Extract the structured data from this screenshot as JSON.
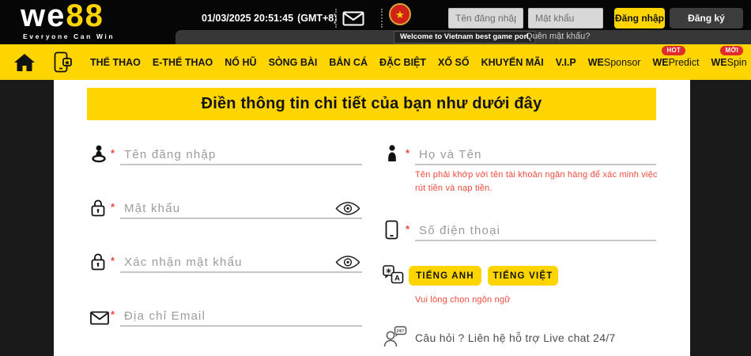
{
  "header": {
    "logo_we": "we",
    "logo_88": "88",
    "tagline": "Everyone Can Win",
    "datetime": "01/03/2025 20:51:45",
    "timezone": "(GMT+8)",
    "username_placeholder": "Tên đăng nhập",
    "password_placeholder": "Mật khẩu",
    "login_label": "Đăng nhập",
    "register_label": "Đăng ký",
    "forgot_label": "Quên mật khẩu?",
    "ticker": "Welcome to Vietnam best game porl",
    "flag_star": "★"
  },
  "nav": {
    "items": [
      "THỂ THAO",
      "E-THỂ THAO",
      "NỔ HŨ",
      "SÒNG BÀI",
      "BẮN CÁ",
      "ĐẶC BIỆT",
      "XỔ SỐ",
      "KHUYẾN MÃI",
      "V.I.P"
    ],
    "we_items": [
      {
        "prefix": "WE",
        "rest": "Sponsor"
      },
      {
        "prefix": "WE",
        "rest": "Predict",
        "badge": "HOT"
      },
      {
        "prefix": "WE",
        "rest": "Spin",
        "badge": "MỚI"
      }
    ]
  },
  "form": {
    "title": "Điền thông tin chi tiết của bạn như dưới đây",
    "required_marker": "*",
    "username_placeholder": "Tên đăng nhập",
    "password_placeholder": "Mật khẩu",
    "confirm_password_placeholder": "Xác nhận mật khẩu",
    "email_placeholder": "Địa chỉ Email",
    "fullname_placeholder": "Họ và Tên",
    "fullname_note": "Tên phải khớp với tên tài khoản ngân hàng để xác minh việc rút tiền và nạp tiền.",
    "phone_placeholder": "Số điện thoại",
    "lang_en_label": "TIẾNG ANH",
    "lang_vi_label": "TIẾNG VIỆT",
    "lang_note": "Vui lòng chọn ngôn ngữ",
    "support_text": "Câu hỏi ? Liên hệ hỗ trợ Live chat 24/7",
    "support_badge": "24/7"
  },
  "colors": {
    "brand_yellow": "#fed500",
    "badge_red": "#e32b2b",
    "note_red": "#f14a3c",
    "header_black": "#060606",
    "flag_red": "#cf2317"
  }
}
